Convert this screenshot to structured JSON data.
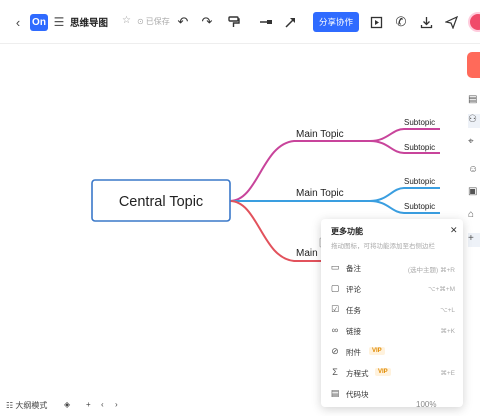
{
  "header": {
    "back_icon": "chevron-left-icon",
    "logo_text": "On",
    "title": "思维导图",
    "saved_status": "已保存",
    "share_label": "分享协作"
  },
  "mindmap": {
    "central": "Central Topic",
    "main_topics": [
      "Main Topic",
      "Main Topic",
      "Main"
    ],
    "subtopics": [
      "Subtopic",
      "Subtopic",
      "Subtopic",
      "Subtopic"
    ],
    "colors": {
      "branch1": "#c8449b",
      "branch2": "#3a9ee0",
      "branch3": "#e2525c",
      "central_border": "#3a78c9"
    }
  },
  "panel": {
    "title": "更多功能",
    "subtitle": "拖动图标，可将功能添加至右侧边栏",
    "items": [
      {
        "label": "备注",
        "shortcut": "(选中主题) ⌘+R",
        "icon": "note-icon",
        "vip": ""
      },
      {
        "label": "评论",
        "shortcut": "⌥+⌘+M",
        "icon": "comment-icon",
        "vip": ""
      },
      {
        "label": "任务",
        "shortcut": "⌥+L",
        "icon": "task-icon",
        "vip": ""
      },
      {
        "label": "链接",
        "shortcut": "⌘+K",
        "icon": "link-icon",
        "vip": ""
      },
      {
        "label": "附件",
        "shortcut": "",
        "icon": "attachment-icon",
        "vip": "VIP"
      },
      {
        "label": "方程式",
        "shortcut": "⌘+E",
        "icon": "formula-icon",
        "vip": "VIP"
      },
      {
        "label": "代码块",
        "shortcut": "",
        "icon": "code-icon",
        "vip": ""
      }
    ]
  },
  "bottom": {
    "outline_mode": "大纲模式",
    "zoom": "100%"
  }
}
